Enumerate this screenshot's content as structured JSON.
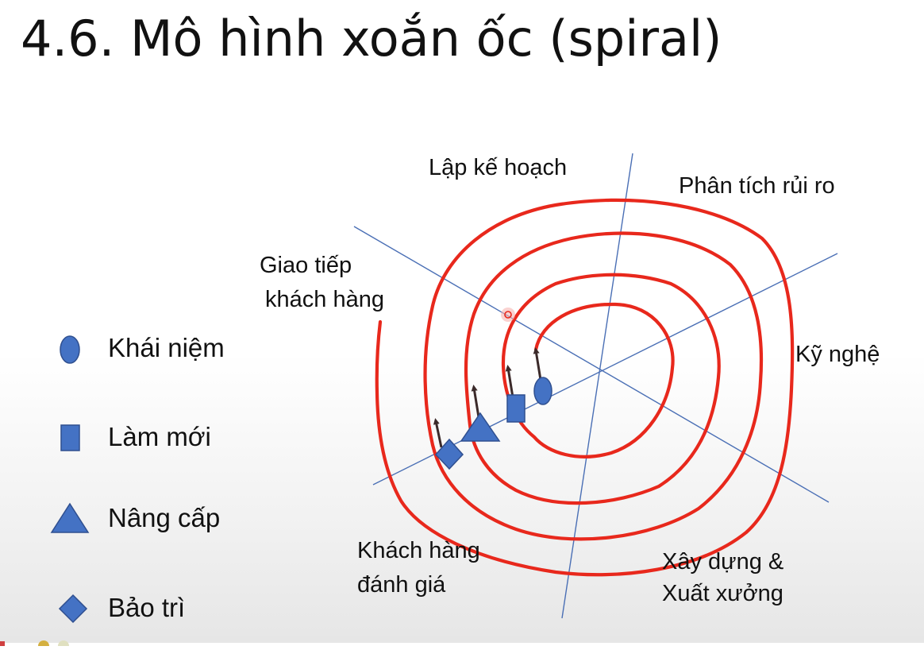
{
  "slide": {
    "title": "4.6. Mô hình xoắn ốc (spiral)"
  },
  "diagram": {
    "regions": {
      "planning": "Lập kế hoạch",
      "risk_analysis": "Phân tích rủi ro",
      "customer_communication_line1": "Giao tiếp",
      "customer_communication_line2": "khách hàng",
      "engineering": "Kỹ nghệ",
      "customer_evaluation_line1": "Khách hàng",
      "customer_evaluation_line2": "đánh giá",
      "construction_line1": "Xây dựng &",
      "construction_line2": "Xuất xưởng"
    },
    "colors": {
      "spiral": "#e8281c",
      "axis": "#4a6fb5",
      "marker_fill": "#4472c4",
      "marker_stroke": "#2f4f8f",
      "arrow": "#3b2a2a"
    },
    "markers": [
      {
        "shape": "ellipse",
        "meaning": "Khái niệm"
      },
      {
        "shape": "square",
        "meaning": "Làm mới"
      },
      {
        "shape": "triangle",
        "meaning": "Nâng cấp"
      },
      {
        "shape": "diamond",
        "meaning": "Bảo trì"
      }
    ]
  },
  "legend": {
    "items": [
      {
        "icon": "ellipse-icon",
        "label": "Khái niệm"
      },
      {
        "icon": "square-icon",
        "label": "Làm mới"
      },
      {
        "icon": "triangle-icon",
        "label": "Nâng cấp"
      },
      {
        "icon": "diamond-icon",
        "label": "Bảo trì"
      }
    ]
  }
}
